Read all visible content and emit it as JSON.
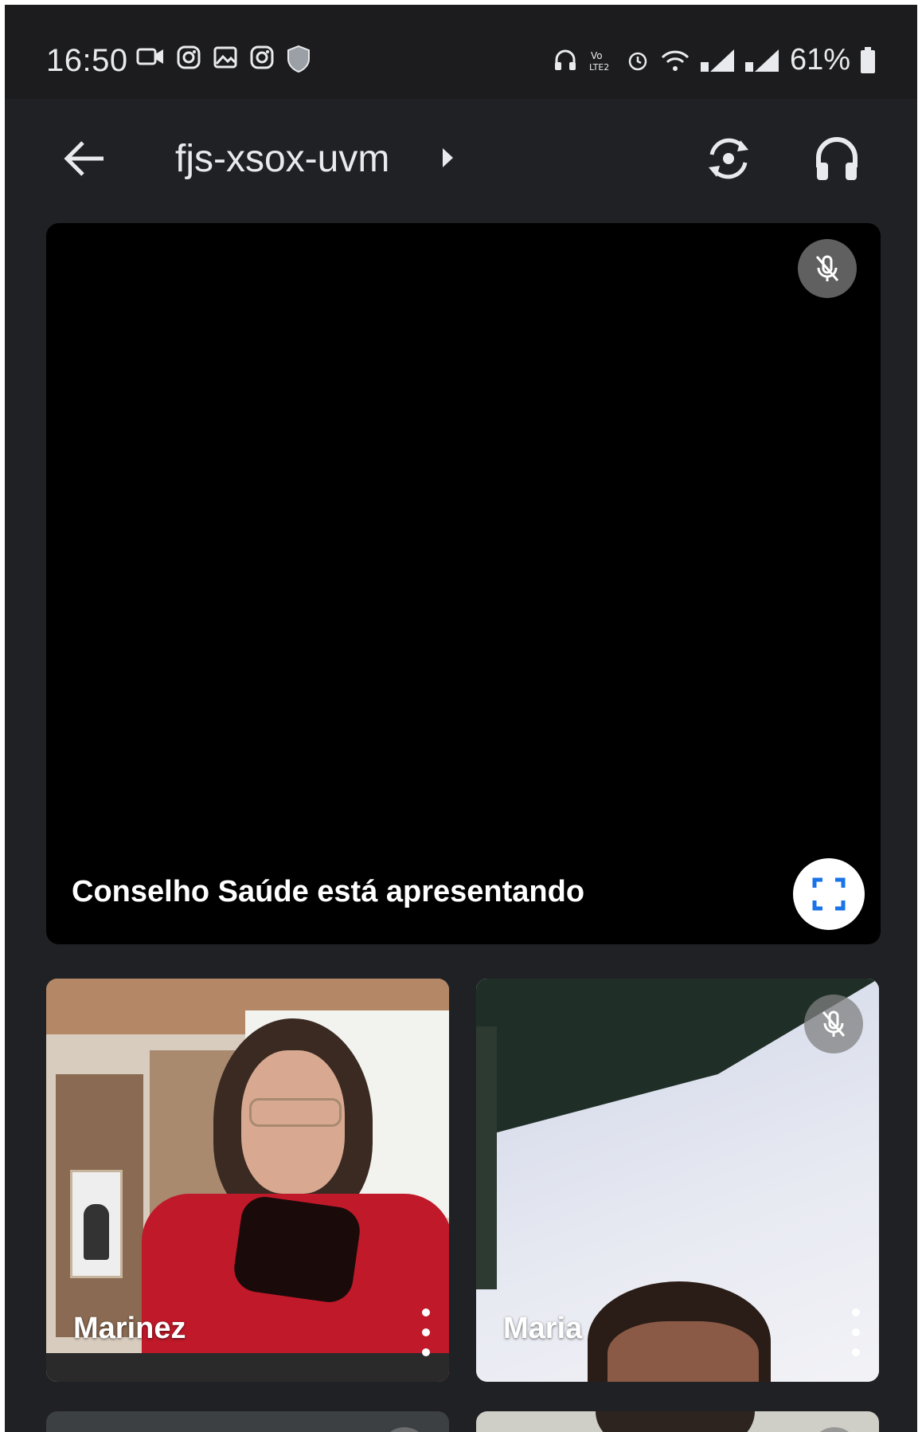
{
  "status_bar": {
    "time": "16:50",
    "left_icons": [
      "video-camera-icon",
      "instagram-icon",
      "gallery-icon",
      "instagram-icon",
      "shield-icon"
    ],
    "right_icons": [
      "headset-icon",
      "volte-icon",
      "alarm-icon",
      "wifi-icon",
      "signal-icon",
      "signal-icon"
    ],
    "battery_percent": "61%"
  },
  "app_bar": {
    "meeting_code": "fjs-xsox-uvm",
    "actions": [
      "switch-camera-icon",
      "audio-output-icon"
    ]
  },
  "presentation": {
    "label": "Conselho Saúde está apresentando",
    "muted": true
  },
  "participants": [
    {
      "name": "Marinez",
      "muted": false
    },
    {
      "name": "Maria",
      "muted": true
    }
  ],
  "colors": {
    "background": "#202124",
    "tile_black": "#000000",
    "text": "#e8eaed",
    "accent_blue": "#1a73e8"
  }
}
